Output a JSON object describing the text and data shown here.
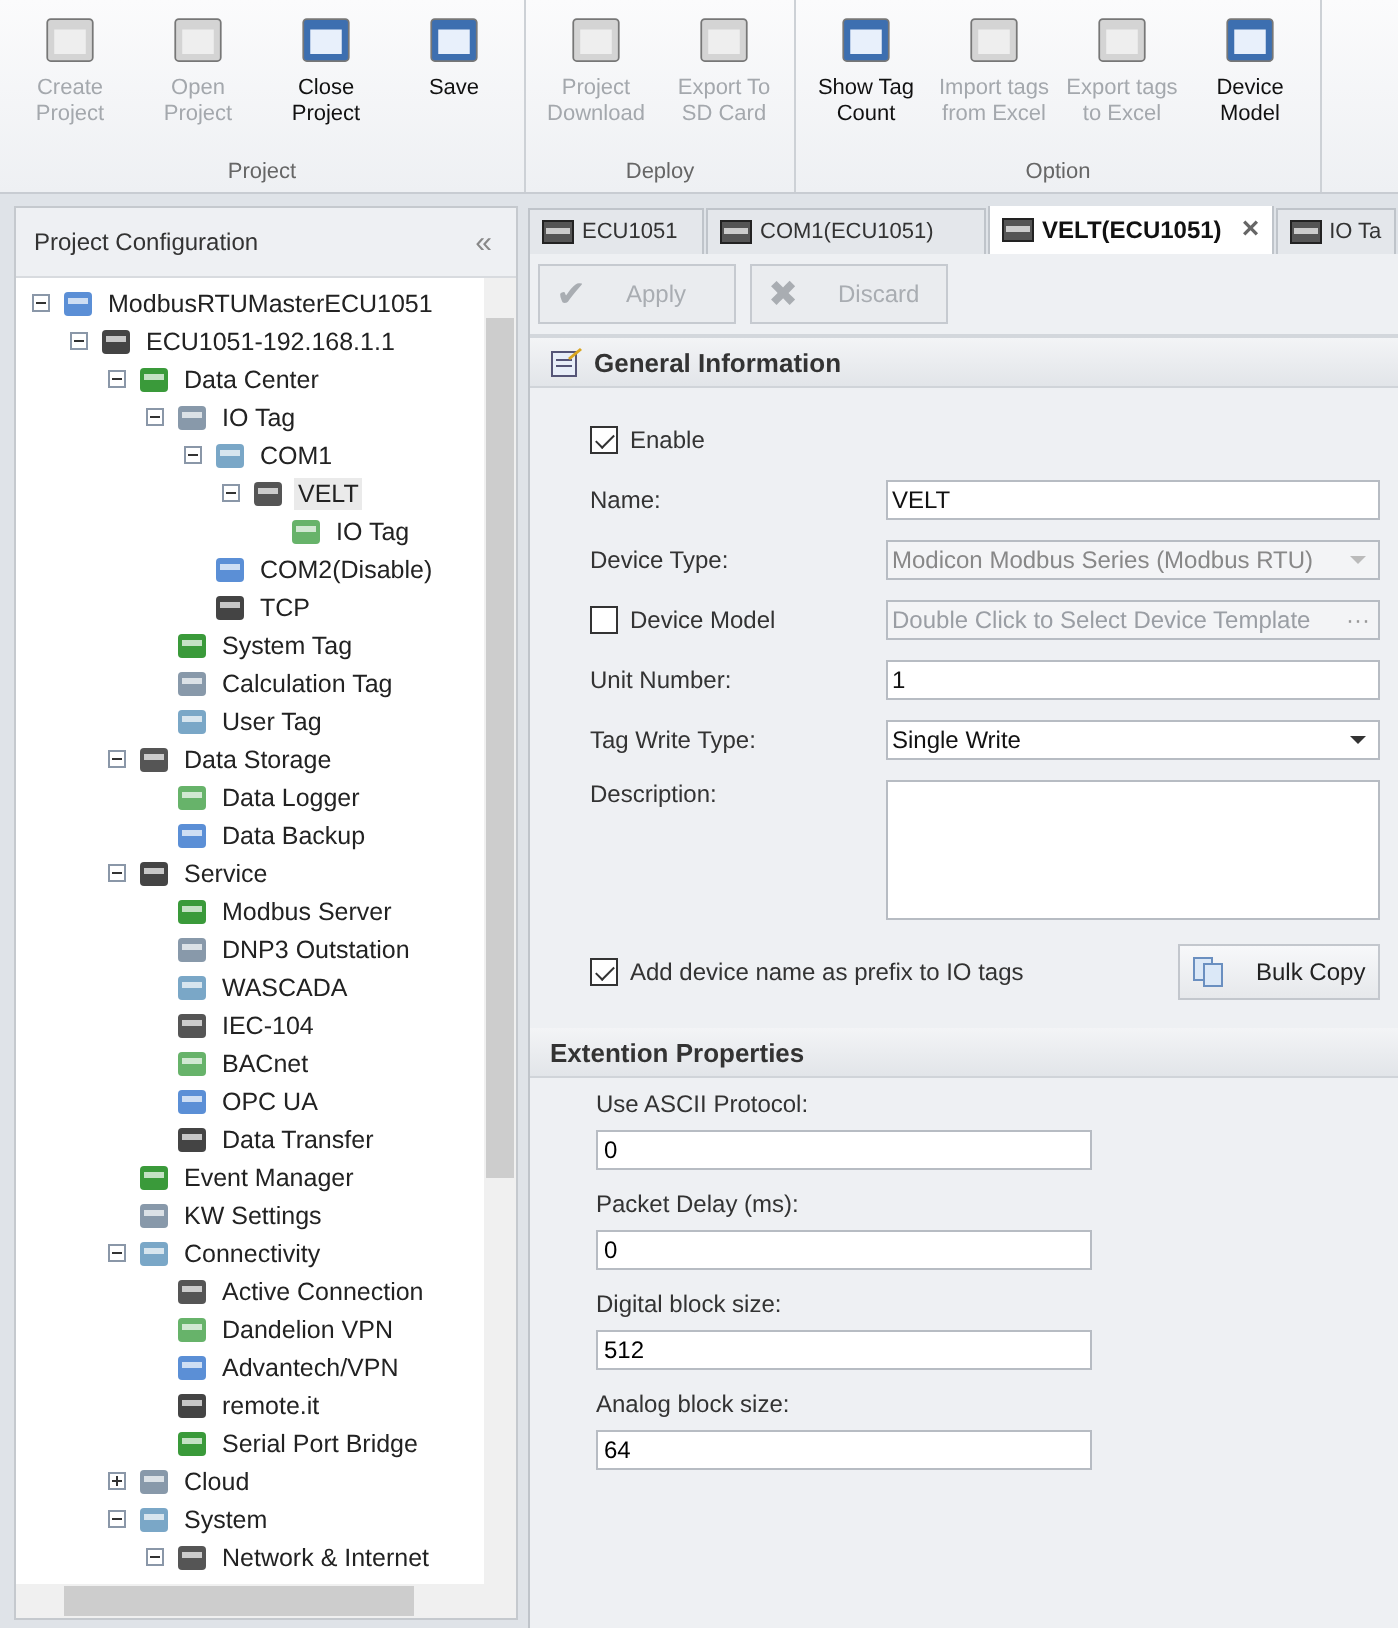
{
  "ribbon": {
    "groups": [
      {
        "label": "Project",
        "buttons": [
          {
            "label": "Create Project",
            "disabled": true
          },
          {
            "label": "Open Project",
            "disabled": true
          },
          {
            "label": "Close Project",
            "disabled": false
          },
          {
            "label": "Save",
            "disabled": false
          }
        ]
      },
      {
        "label": "Deploy",
        "buttons": [
          {
            "label": "Project Download",
            "disabled": true
          },
          {
            "label": "Export To SD Card",
            "disabled": true
          }
        ]
      },
      {
        "label": "Option",
        "buttons": [
          {
            "label": "Show Tag Count",
            "disabled": false
          },
          {
            "label": "Import tags from Excel",
            "disabled": true
          },
          {
            "label": "Export tags to Excel",
            "disabled": true
          },
          {
            "label": "Device Model",
            "disabled": false
          }
        ]
      }
    ]
  },
  "sidebar": {
    "title": "Project Configuration",
    "collapse": "«",
    "tree": [
      {
        "label": "ModbusRTUMasterECU1051",
        "expanded": true,
        "selected": false,
        "children": [
          {
            "label": "ECU1051-192.168.1.1",
            "expanded": true,
            "selected": false,
            "children": [
              {
                "label": "Data Center",
                "expanded": true,
                "selected": false,
                "children": [
                  {
                    "label": "IO Tag",
                    "expanded": true,
                    "selected": false,
                    "children": [
                      {
                        "label": "COM1",
                        "expanded": true,
                        "selected": false,
                        "children": [
                          {
                            "label": "VELT",
                            "expanded": true,
                            "selected": true,
                            "children": [
                              {
                                "label": "IO Tag",
                                "selected": false
                              }
                            ]
                          }
                        ]
                      },
                      {
                        "label": "COM2(Disable)",
                        "selected": false
                      },
                      {
                        "label": "TCP",
                        "selected": false
                      }
                    ]
                  },
                  {
                    "label": "System Tag",
                    "selected": false
                  },
                  {
                    "label": "Calculation Tag",
                    "selected": false
                  },
                  {
                    "label": "User Tag",
                    "selected": false
                  }
                ]
              },
              {
                "label": "Data Storage",
                "expanded": true,
                "selected": false,
                "children": [
                  {
                    "label": "Data Logger",
                    "selected": false
                  },
                  {
                    "label": "Data Backup",
                    "selected": false
                  }
                ]
              },
              {
                "label": "Service",
                "expanded": true,
                "selected": false,
                "children": [
                  {
                    "label": "Modbus Server",
                    "selected": false
                  },
                  {
                    "label": "DNP3 Outstation",
                    "selected": false
                  },
                  {
                    "label": "WASCADA",
                    "selected": false
                  },
                  {
                    "label": "IEC-104",
                    "selected": false
                  },
                  {
                    "label": "BACnet",
                    "selected": false
                  },
                  {
                    "label": "OPC UA",
                    "selected": false
                  },
                  {
                    "label": "Data Transfer",
                    "selected": false
                  }
                ]
              },
              {
                "label": "Event Manager",
                "selected": false
              },
              {
                "label": "KW Settings",
                "selected": false
              },
              {
                "label": "Connectivity",
                "expanded": true,
                "selected": false,
                "children": [
                  {
                    "label": "Active Connection",
                    "selected": false
                  },
                  {
                    "label": "Dandelion VPN",
                    "selected": false
                  },
                  {
                    "label": "Advantech/VPN",
                    "selected": false
                  },
                  {
                    "label": "remote.it",
                    "selected": false
                  },
                  {
                    "label": "Serial Port Bridge",
                    "selected": false
                  }
                ]
              },
              {
                "label": "Cloud",
                "expanded": false,
                "selected": false
              },
              {
                "label": "System",
                "expanded": true,
                "selected": false,
                "children": [
                  {
                    "label": "Network & Internet",
                    "expanded": true,
                    "selected": false
                  }
                ]
              }
            ]
          }
        ]
      }
    ]
  },
  "tabs": [
    {
      "label": "ECU1051",
      "selected": false
    },
    {
      "label": "COM1(ECU1051)",
      "selected": false
    },
    {
      "label": "VELT(ECU1051)",
      "selected": true,
      "close": "×"
    },
    {
      "label": "IO Ta",
      "selected": false
    }
  ],
  "toolbar": [
    {
      "label": "Apply",
      "disabled": true,
      "glyph": "✔"
    },
    {
      "label": "Discard",
      "disabled": true,
      "glyph": "✖"
    }
  ],
  "general": {
    "title": "General Information",
    "rows": [
      {
        "kind": "checkbox",
        "label": "Enable",
        "checked": true
      },
      {
        "kind": "text",
        "label": "Name:",
        "value": "VELT"
      },
      {
        "kind": "dropdown",
        "label": "Device Type:",
        "value": "Modicon Modbus Series (Modbus RTU)",
        "disabled": true
      },
      {
        "kind": "check-field",
        "label": "Device Model",
        "checked": false,
        "placeholder": "Double Click to Select Device Template",
        "button": "···"
      },
      {
        "kind": "text",
        "label": "Unit Number:",
        "value": "1"
      },
      {
        "kind": "dropdown",
        "label": "Tag Write Type:",
        "value": "Single Write",
        "disabled": false
      },
      {
        "kind": "textarea",
        "label": "Description:"
      }
    ],
    "prefix": {
      "label": "Add device name as prefix to IO tags",
      "checked": true
    },
    "bulk_copy": "Bulk Copy"
  },
  "extension": {
    "title": "Extention Properties",
    "fields": [
      {
        "label": "Use ASCII Protocol:",
        "value": "0"
      },
      {
        "label": "Packet Delay (ms):",
        "value": "0"
      },
      {
        "label": "Digital block size:",
        "value": "512"
      },
      {
        "label": "Analog block size:",
        "value": "64"
      }
    ]
  }
}
